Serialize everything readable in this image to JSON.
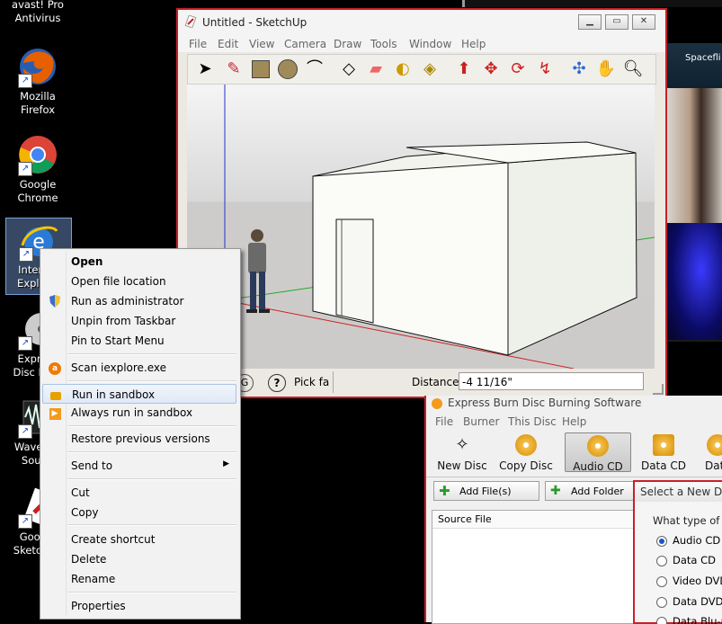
{
  "desktop": {
    "icons": [
      {
        "label": "avast! Pro Antivirus"
      },
      {
        "label": "Mozilla Firefox"
      },
      {
        "label": "Google Chrome"
      },
      {
        "label": "Internet Explorer"
      },
      {
        "label": "Express Disc Burn"
      },
      {
        "label": "WavePad Sound Editor"
      },
      {
        "label": "Google SketchUp"
      }
    ]
  },
  "sketchup": {
    "title": "Untitled - SketchUp",
    "menu": [
      "File",
      "Edit",
      "View",
      "Camera",
      "Draw",
      "Tools",
      "Window",
      "Help"
    ],
    "status": {
      "hint": "Pick fa",
      "measure_label": "Distance",
      "measure_value": "-4 11/16\""
    },
    "colors": {
      "axis_red": "#cc2222",
      "axis_green": "#22aa22",
      "axis_blue": "#2233cc"
    }
  },
  "context_menu": {
    "items": [
      {
        "label": "Open",
        "bold": true
      },
      {
        "label": "Open file location"
      },
      {
        "label": "Run as administrator",
        "icon": "shield-icon"
      },
      {
        "label": "Unpin from Taskbar"
      },
      {
        "label": "Pin to Start Menu"
      },
      {
        "label": "Scan iexplore.exe",
        "icon": "avast-icon"
      },
      {
        "label": "Run in sandbox",
        "icon": "lock-icon",
        "highlighted": true
      },
      {
        "label": "Always run in sandbox",
        "icon": "sandbox-icon"
      },
      {
        "label": "Restore previous versions"
      },
      {
        "label": "Send to",
        "submenu": true
      },
      {
        "label": "Cut"
      },
      {
        "label": "Copy"
      },
      {
        "label": "Create shortcut"
      },
      {
        "label": "Delete"
      },
      {
        "label": "Rename"
      },
      {
        "label": "Properties"
      }
    ]
  },
  "express_burn": {
    "title": "Express Burn Disc Burning Software",
    "menu": [
      "File",
      "Burner",
      "This Disc",
      "Help"
    ],
    "toolbar": [
      "New Disc",
      "Copy Disc",
      "Audio CD",
      "Data CD",
      "Data"
    ],
    "add_file": "Add File(s)",
    "add_folder": "Add Folder",
    "column_source": "Source File",
    "dialog": {
      "title": "Select a New Disc",
      "question": "What type of di",
      "options": [
        "Audio CD",
        "Data CD",
        "Video DVD",
        "Data DVD",
        "Data Blu-ra"
      ],
      "selected": "Audio CD"
    }
  },
  "background_window": {
    "label": "Spacefli"
  }
}
